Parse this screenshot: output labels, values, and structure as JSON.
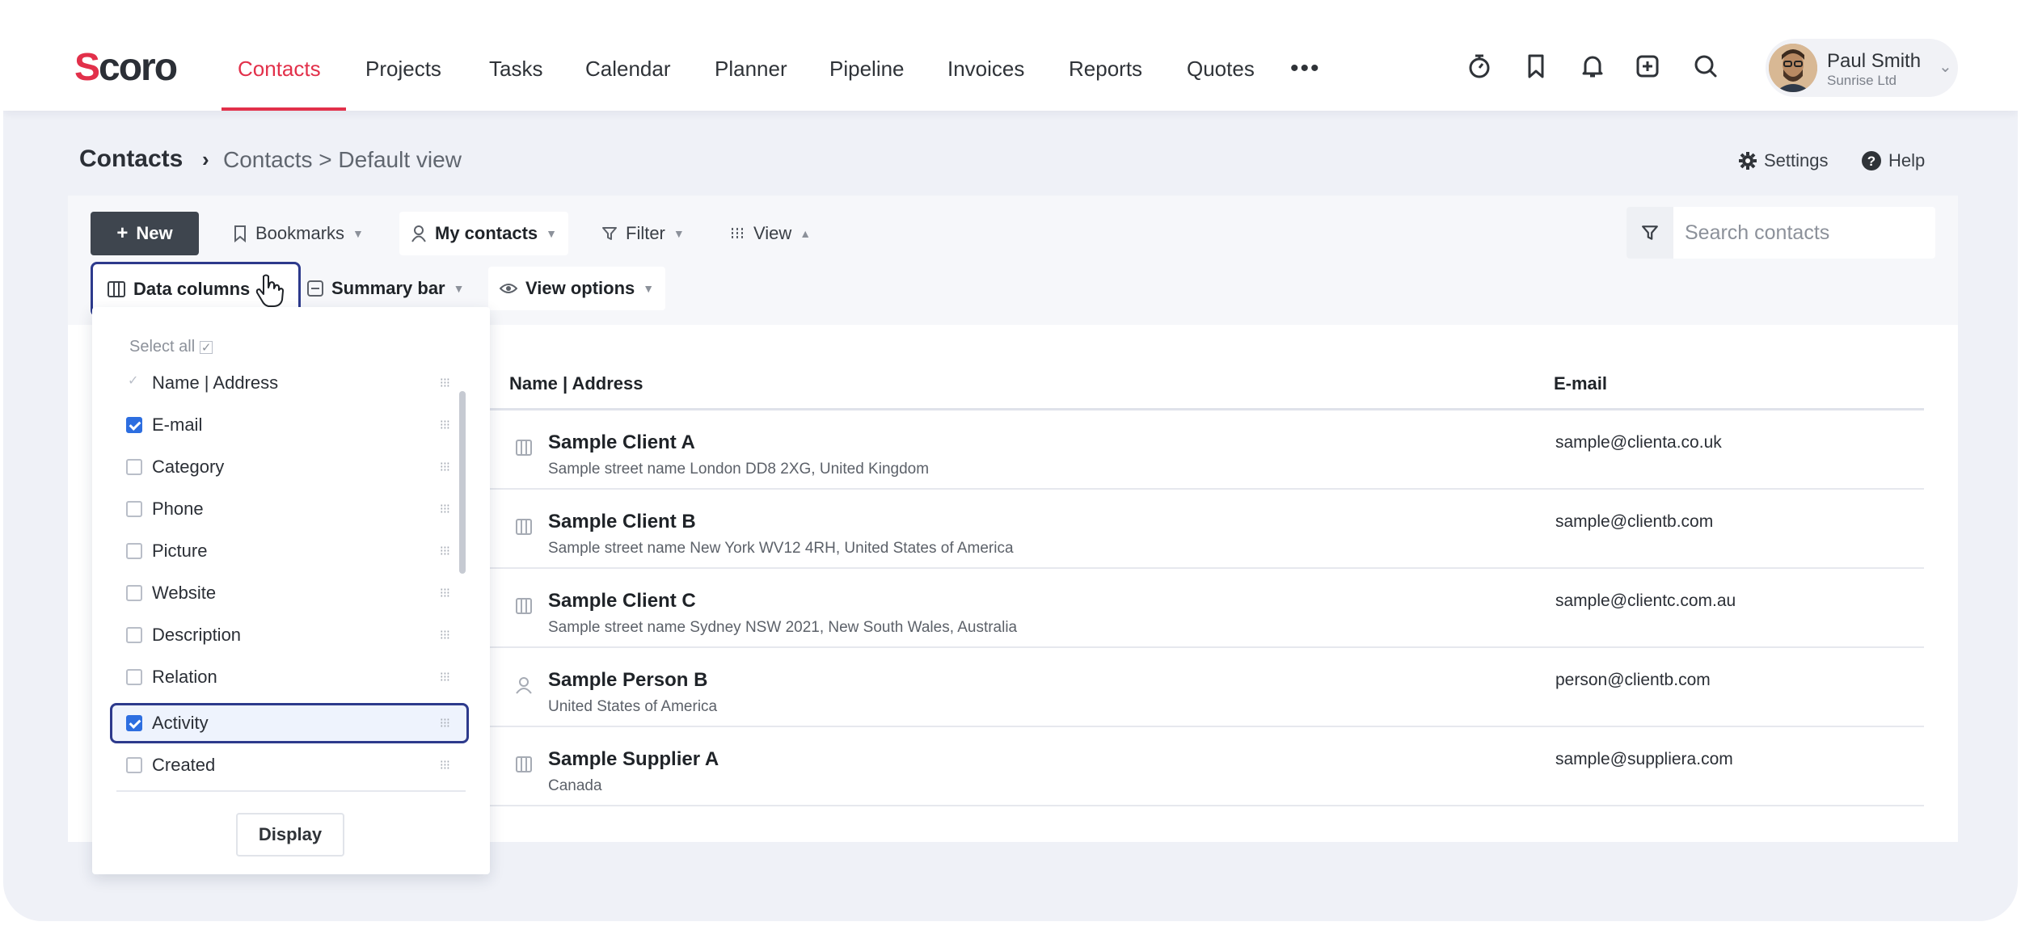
{
  "app": {
    "logo": "Scoro",
    "logo_first": "S",
    "logo_rest": "coro"
  },
  "nav": {
    "items": [
      {
        "label": "Contacts",
        "active": true
      },
      {
        "label": "Projects"
      },
      {
        "label": "Tasks"
      },
      {
        "label": "Calendar"
      },
      {
        "label": "Planner"
      },
      {
        "label": "Pipeline"
      },
      {
        "label": "Invoices"
      },
      {
        "label": "Reports"
      },
      {
        "label": "Quotes"
      }
    ],
    "more": "•••",
    "icons": [
      "stopwatch-icon",
      "bookmark-icon",
      "bell-icon",
      "plus-square-icon",
      "search-icon"
    ],
    "accent": "#e2304a"
  },
  "user": {
    "name": "Paul Smith",
    "company": "Sunrise Ltd"
  },
  "breadcrumb": {
    "main": "Contacts",
    "separator": "›",
    "sub": "Contacts > Default view"
  },
  "header_links": {
    "settings": "Settings",
    "help": "Help"
  },
  "toolbar": {
    "new": "New",
    "bookmarks": "Bookmarks",
    "my_contacts": "My contacts",
    "filter": "Filter",
    "view": "View",
    "data_columns": "Data columns",
    "summary_bar": "Summary bar",
    "view_options": "View options"
  },
  "search": {
    "placeholder": "Search contacts"
  },
  "table": {
    "columns": [
      "Name | Address",
      "E-mail"
    ],
    "rows": [
      {
        "type": "company",
        "name": "Sample Client A",
        "address": "Sample street name London DD8 2XG, United Kingdom",
        "email": "sample@clienta.co.uk"
      },
      {
        "type": "company",
        "name": "Sample Client B",
        "address": "Sample street name New York WV12 4RH, United States of America",
        "email": "sample@clientb.com"
      },
      {
        "type": "company",
        "name": "Sample Client C",
        "address": "Sample street name Sydney NSW 2021, New South Wales, Australia",
        "email": "sample@clientc.com.au"
      },
      {
        "type": "person",
        "name": "Sample Person B",
        "address": "United States of America",
        "email": "person@clientb.com"
      },
      {
        "type": "company",
        "name": "Sample Supplier A",
        "address": "Canada",
        "email": "sample@suppliera.com"
      }
    ]
  },
  "dropdown": {
    "select_all": "Select all",
    "options": [
      {
        "label": "Name | Address",
        "state": "locked"
      },
      {
        "label": "E-mail",
        "state": "checked"
      },
      {
        "label": "Category",
        "state": "unchecked"
      },
      {
        "label": "Phone",
        "state": "unchecked"
      },
      {
        "label": "Picture",
        "state": "unchecked"
      },
      {
        "label": "Website",
        "state": "unchecked"
      },
      {
        "label": "Description",
        "state": "unchecked"
      },
      {
        "label": "Relation",
        "state": "unchecked"
      },
      {
        "label": "Activity",
        "state": "checked"
      },
      {
        "label": "Created",
        "state": "unchecked"
      }
    ],
    "display": "Display"
  }
}
